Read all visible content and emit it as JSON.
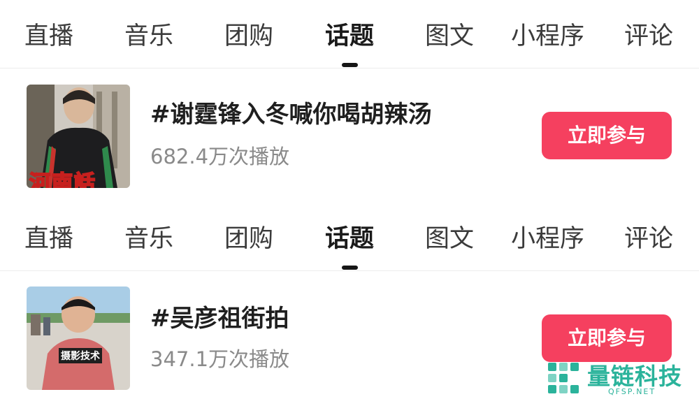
{
  "sections": [
    {
      "tabs": [
        {
          "label": "直播"
        },
        {
          "label": "音乐"
        },
        {
          "label": "团购"
        },
        {
          "label": "话题"
        },
        {
          "label": "图文"
        },
        {
          "label": "小程序"
        },
        {
          "label": "评论"
        }
      ],
      "active_tab": "话题",
      "topic": {
        "title": "#谢霆锋入冬喊你喝胡辣汤",
        "plays": "682.4万次播放",
        "button_label": "立即参与",
        "thumb_caption": "河南話"
      }
    },
    {
      "tabs": [
        {
          "label": "直播"
        },
        {
          "label": "音乐"
        },
        {
          "label": "团购"
        },
        {
          "label": "话题"
        },
        {
          "label": "图文"
        },
        {
          "label": "小程序"
        },
        {
          "label": "评论"
        }
      ],
      "active_tab": "话题",
      "topic": {
        "title": "#吴彦祖街拍",
        "plays": "347.1万次播放",
        "button_label": "立即参与",
        "thumb_caption": "摄影技术"
      }
    }
  ],
  "watermark": {
    "name": "量链科技",
    "domain": "QFSP.NET"
  },
  "colors": {
    "accent": "#f5405f",
    "watermark": "#2bb39b",
    "active_tab": "#1a1a1a",
    "tab": "#3b3b3b",
    "secondary_text": "#8a8a8a"
  }
}
